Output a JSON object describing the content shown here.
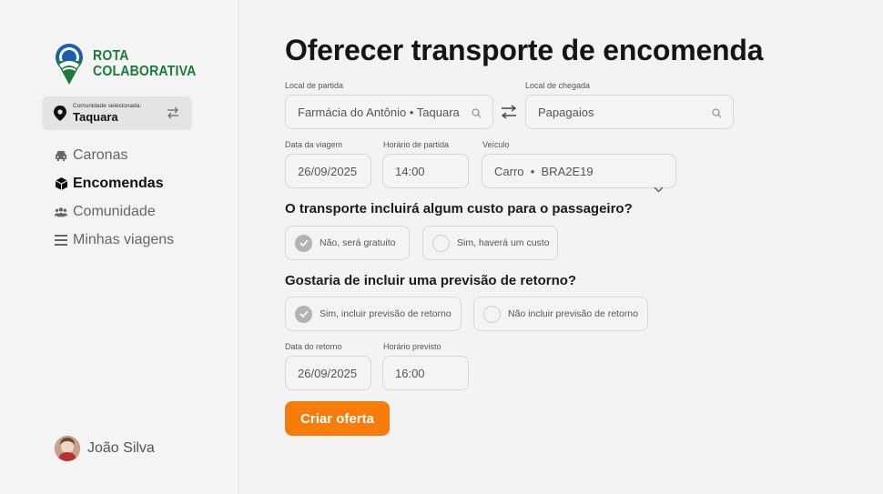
{
  "brand": {
    "line1": "ROTA",
    "line2": "COLABORATIVA",
    "color": "#1d7a3a"
  },
  "community": {
    "caption": "Comunidade selecionada:",
    "name": "Taquara"
  },
  "nav": [
    {
      "label": "Caronas",
      "icon": "car-icon",
      "active": false
    },
    {
      "label": "Encomendas",
      "icon": "package-icon",
      "active": true
    },
    {
      "label": "Comunidade",
      "icon": "users-icon",
      "active": false
    },
    {
      "label": "Minhas viagens",
      "icon": "menu-icon",
      "active": false
    }
  ],
  "user": {
    "name": "João Silva"
  },
  "page": {
    "title": "Oferecer transporte de encomenda"
  },
  "route": {
    "from_label": "Local de partida",
    "from_value": "Farmácia do Antônio • Taquara",
    "to_label": "Local de chegada",
    "to_value": "Papagaios"
  },
  "trip": {
    "date_label": "Data da viagem",
    "date_value": "26/09/2025",
    "time_label": "Horário de partida",
    "time_value": "14:00",
    "vehicle_label": "Veículo",
    "vehicle_value": "Carro  •  BRA2E19"
  },
  "cost": {
    "question": "O transporte incluirá algum custo para o passageiro?",
    "opt_no": "Não, será gratuito",
    "opt_yes": "Sim, haverá um custo",
    "selected": "no"
  },
  "return": {
    "question": "Gostaria de incluir uma previsão de retorno?",
    "opt_yes": "Sim, incluir previsão de retorno",
    "opt_no": "Não incluir previsão de retorno",
    "selected": "yes",
    "date_label": "Data do retorno",
    "date_value": "26/09/2025",
    "time_label": "Horário previsto",
    "time_value": "16:00"
  },
  "submit": {
    "label": "Criar oferta",
    "color": "#f87c0b"
  }
}
